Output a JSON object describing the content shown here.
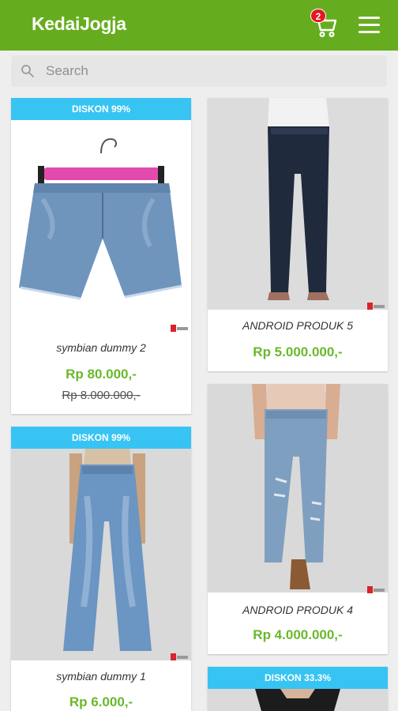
{
  "app": {
    "title": "KedaiJogja",
    "cart_count": "2",
    "brand_color": "#65ad1e",
    "accent_color": "#37c4f3",
    "price_color": "#6ab82c"
  },
  "icons": {
    "cart": "cart-icon",
    "menu": "hamburger-menu-icon",
    "search": "search-icon"
  },
  "search": {
    "placeholder": "Search"
  },
  "products": [
    {
      "discount": "DISKON 99%",
      "name": "symbian dummy 2",
      "price": "Rp 80.000,-",
      "old_price": "Rp 8.000.000,-",
      "image": "denim-shorts-on-hanger"
    },
    {
      "discount": "",
      "name": "ANDROID PRODUK 5",
      "price": "Rp 5.000.000,-",
      "old_price": "",
      "image": "dark-skinny-jeans-model"
    },
    {
      "discount": "DISKON 99%",
      "name": "symbian dummy 1",
      "price": "Rp 6.000,-",
      "old_price": "",
      "image": "light-bootcut-jeans-model"
    },
    {
      "discount": "",
      "name": "ANDROID PRODUK 4",
      "price": "Rp 4.000.000,-",
      "old_price": "",
      "image": "distressed-skinny-jeans-model"
    },
    {
      "discount": "DISKON 33.3%",
      "name": "",
      "price": "",
      "old_price": "",
      "image": "product-photo-partial"
    }
  ]
}
